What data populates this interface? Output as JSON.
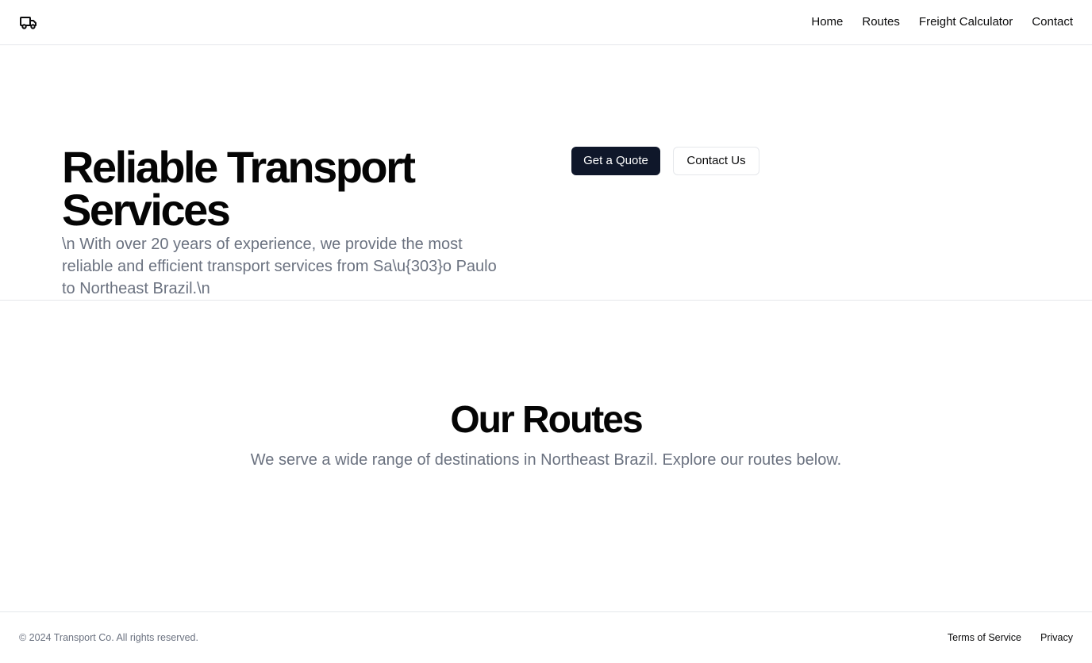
{
  "header": {
    "logo_icon": "truck-icon",
    "nav": [
      {
        "label": "Home"
      },
      {
        "label": "Routes"
      },
      {
        "label": "Freight Calculator"
      },
      {
        "label": "Contact"
      }
    ]
  },
  "hero": {
    "title": "Reliable Transport Services",
    "subtitle": "\\n With over 20 years of experience, we provide the most reliable and efficient transport services from Sa\\u{303}o Paulo to Northeast Brazil.\\n",
    "primary_button": "Get a Quote",
    "secondary_button": "Contact Us"
  },
  "routes": {
    "title": "Our Routes",
    "subtitle": "We serve a wide range of destinations in Northeast Brazil. Explore our routes below."
  },
  "footer": {
    "copyright": "© 2024 Transport Co. All rights reserved.",
    "links": [
      {
        "label": "Terms of Service"
      },
      {
        "label": "Privacy"
      }
    ]
  },
  "colors": {
    "primary_button_bg": "#0f172a",
    "muted_text": "#6b7280",
    "border": "#e5e7eb"
  }
}
